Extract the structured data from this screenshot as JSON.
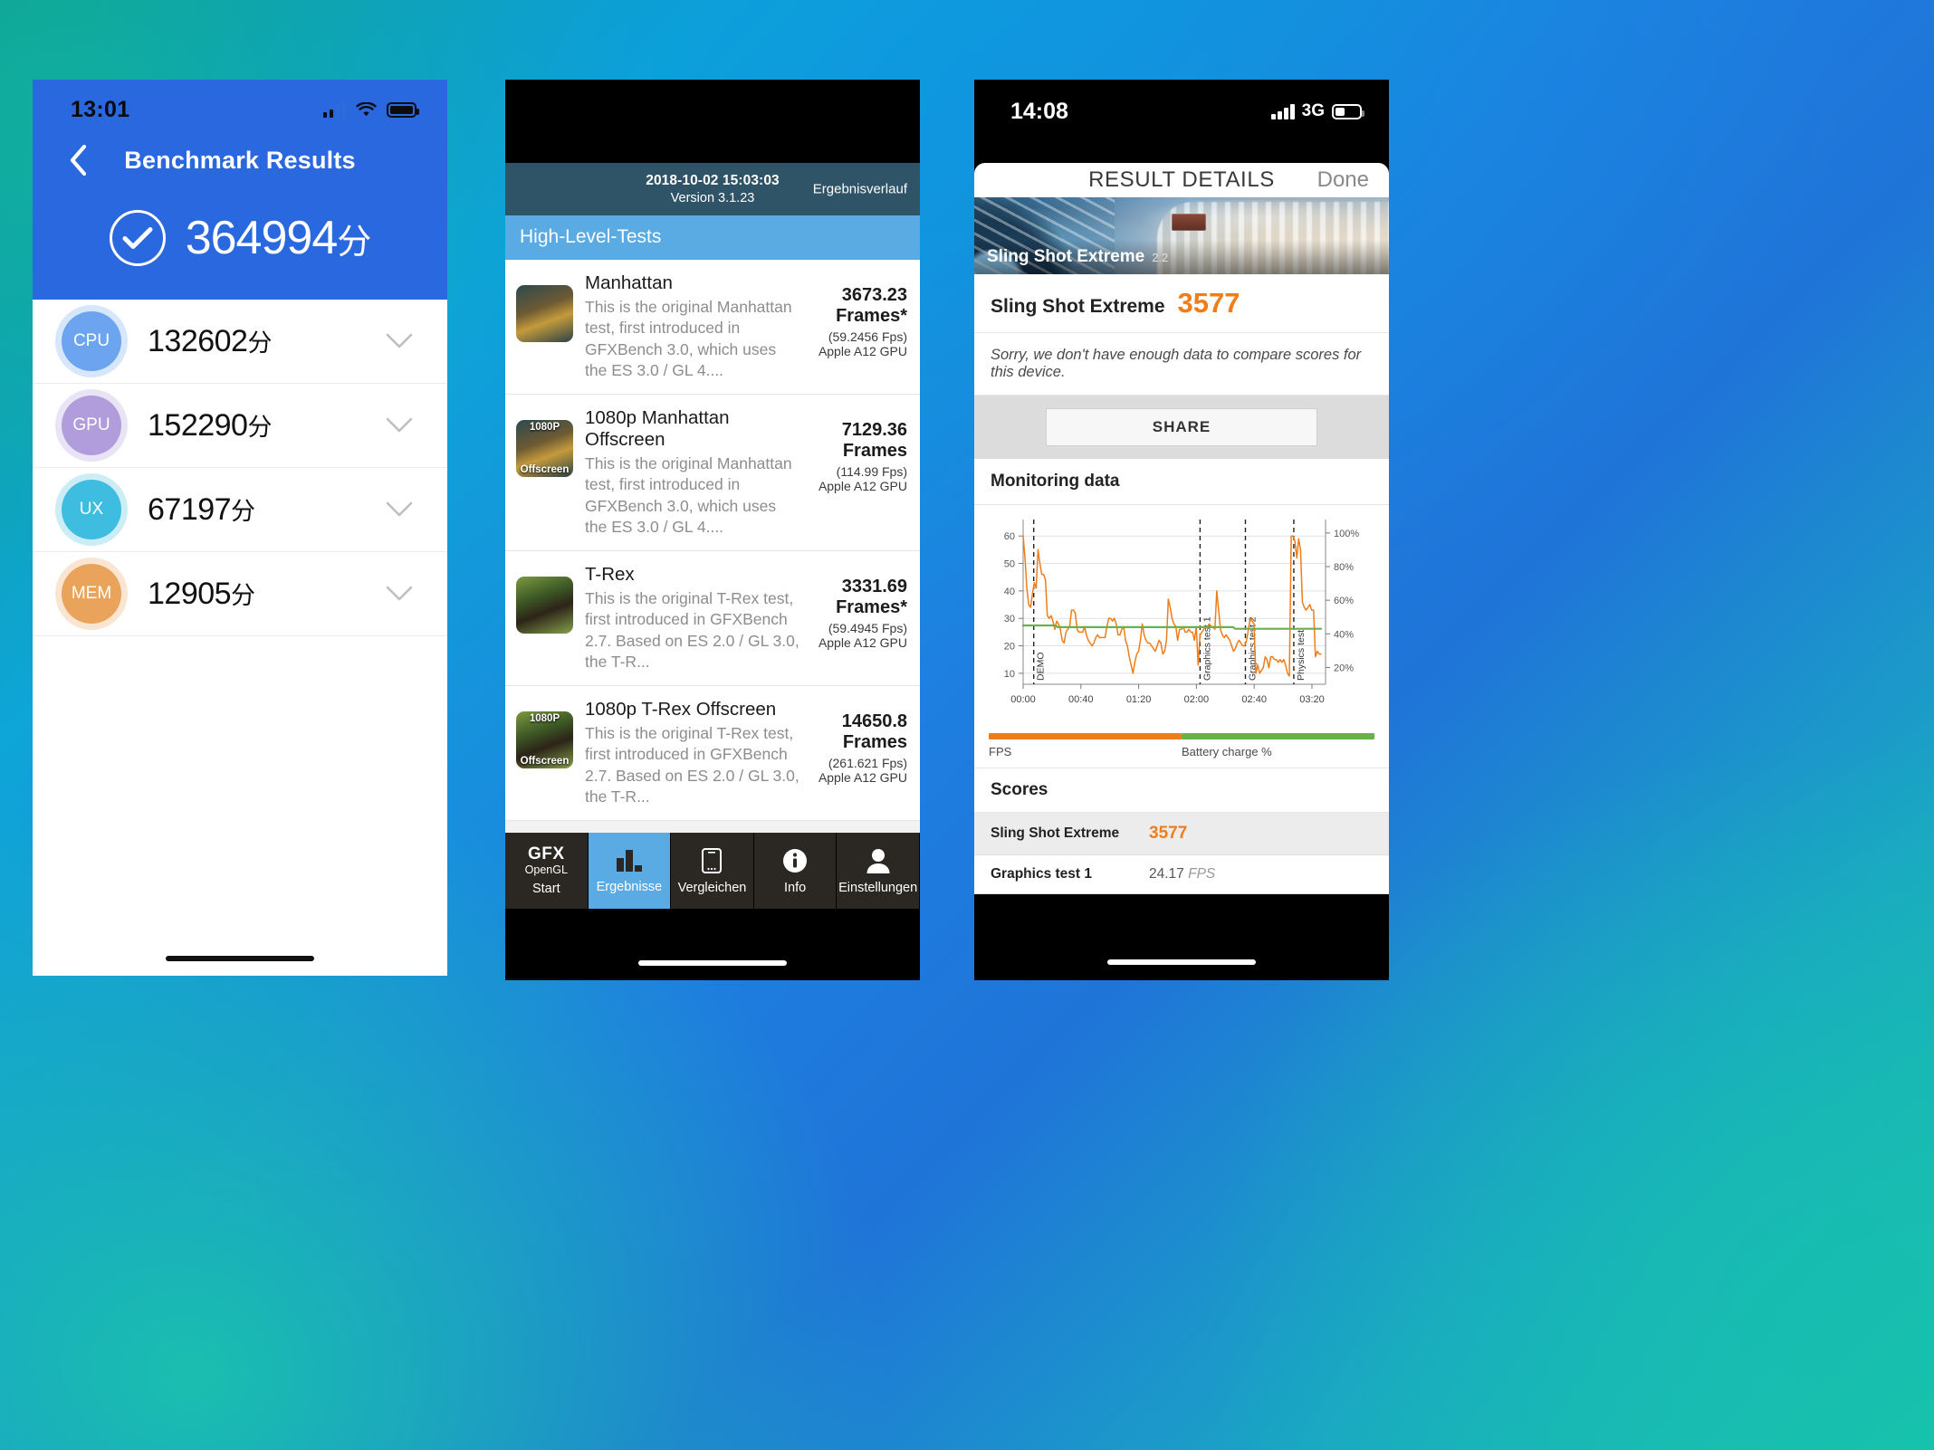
{
  "phone1": {
    "app": "AnTuTu Benchmark",
    "status": {
      "time": "13:01",
      "signal_icon": "signal-bars-icon",
      "wifi_icon": "wifi-icon",
      "battery_icon": "battery-full-icon"
    },
    "nav": {
      "back_icon": "chevron-left-icon",
      "title": "Benchmark Results"
    },
    "total": {
      "check_icon": "check-circle-icon",
      "score": "364994",
      "unit": "分"
    },
    "rows": [
      {
        "badge": "CPU",
        "score": "132602",
        "unit": "分",
        "color": "#6ca4ef",
        "chevron_icon": "chevron-down-icon"
      },
      {
        "badge": "GPU",
        "score": "152290",
        "unit": "分",
        "color": "#b19ddb",
        "chevron_icon": "chevron-down-icon"
      },
      {
        "badge": "UX",
        "score": "67197",
        "unit": "分",
        "color": "#3fbde0",
        "chevron_icon": "chevron-down-icon"
      },
      {
        "badge": "MEM",
        "score": "12905",
        "unit": "分",
        "color": "#e9a35a",
        "chevron_icon": "chevron-down-icon"
      }
    ]
  },
  "phone2": {
    "app": "GFXBench",
    "header": {
      "date": "2018-10-02 15:03:03",
      "version": "Version 3.1.23",
      "history": "Ergebnisverlauf"
    },
    "section_title": "High-Level-Tests",
    "tests": [
      {
        "name": "Manhattan",
        "desc": "This is the original Manhattan test, first introduced in GFXBench 3.0, which uses the ES 3.0 / GL 4....",
        "frames": "3673.23",
        "frames_unit": "Frames*",
        "fps": "(59.2456 Fps)",
        "gpu": "Apple A12 GPU",
        "thumb_top": "",
        "thumb_bottom": "",
        "thumb_kind": "manhattan"
      },
      {
        "name": "1080p Manhattan Offscreen",
        "desc": "This is the original Manhattan test, first introduced in GFXBench 3.0, which uses the ES 3.0 / GL 4....",
        "frames": "7129.36",
        "frames_unit": "Frames",
        "fps": "(114.99 Fps)",
        "gpu": "Apple A12 GPU",
        "thumb_top": "1080P",
        "thumb_bottom": "Offscreen",
        "thumb_kind": "manhattan"
      },
      {
        "name": "T-Rex",
        "desc": "This is the original T-Rex test, first introduced in GFXBench 2.7. Based on ES 2.0 / GL 3.0, the T-R...",
        "frames": "3331.69",
        "frames_unit": "Frames*",
        "fps": "(59.4945 Fps)",
        "gpu": "Apple A12 GPU",
        "thumb_top": "",
        "thumb_bottom": "",
        "thumb_kind": "trex"
      },
      {
        "name": "1080p T-Rex Offscreen",
        "desc": "This is the original T-Rex test, first introduced in GFXBench 2.7. Based on ES 2.0 / GL 3.0, the T-R...",
        "frames": "14650.8",
        "frames_unit": "Frames",
        "fps": "(261.621 Fps)",
        "gpu": "Apple A12 GPU",
        "thumb_top": "1080P",
        "thumb_bottom": "Offscreen",
        "thumb_kind": "trex"
      }
    ],
    "tabs": [
      {
        "label": "Start",
        "icon": "gfx-opengl-logo-icon",
        "brand": "GFX",
        "brand_sub": "OpenGL",
        "active": false
      },
      {
        "label": "Ergebnisse",
        "icon": "bar-chart-icon",
        "active": true
      },
      {
        "label": "Vergleichen",
        "icon": "phone-icon",
        "active": false
      },
      {
        "label": "Info",
        "icon": "info-circle-icon",
        "active": false
      },
      {
        "label": "Einstellungen",
        "icon": "person-icon",
        "active": false
      }
    ]
  },
  "phone3": {
    "app": "3DMark",
    "status": {
      "time": "14:08",
      "signal_icon": "signal-bars-icon",
      "network": "3G",
      "battery_icon": "battery-low-icon"
    },
    "nav": {
      "title": "RESULT DETAILS",
      "done": "Done"
    },
    "hero": {
      "title": "Sling Shot Extreme",
      "version": "2.2"
    },
    "score_line": {
      "label": "Sling Shot Extreme",
      "value": "3577",
      "accent": "#ef7d1a"
    },
    "note": "Sorry, we don't have enough data to compare scores for this device.",
    "share_label": "SHARE",
    "monitoring_title": "Monitoring data",
    "legend": [
      {
        "label": "FPS",
        "color": "#ef7d1a"
      },
      {
        "label": "Battery charge %",
        "color": "#6ab04c"
      }
    ],
    "scores_title": "Scores",
    "score_rows": [
      {
        "label": "Sling Shot Extreme",
        "value": "3577",
        "suffix": "",
        "accent": true
      },
      {
        "label": "Graphics test 1",
        "value": "24.17",
        "suffix": "FPS",
        "accent": false
      }
    ]
  },
  "chart_data": {
    "type": "line",
    "title": "Monitoring data",
    "xlabel": "",
    "ylabel": "FPS",
    "y2label": "Battery charge %",
    "xticks": [
      "00:00",
      "00:40",
      "01:20",
      "02:00",
      "02:40",
      "03:20"
    ],
    "yticks_left": [
      10,
      20,
      30,
      40,
      50,
      60
    ],
    "yticks_right": [
      "20%",
      "40%",
      "60%",
      "80%",
      "100%"
    ],
    "ylim": [
      6,
      66
    ],
    "y2lim": [
      10,
      108
    ],
    "grid": true,
    "legend_position": "bottom",
    "annotations": [
      {
        "label": "DEMO",
        "x": 0.035
      },
      {
        "label": "Graphics test 1",
        "x": 0.585
      },
      {
        "label": "Graphics test 2",
        "x": 0.735
      },
      {
        "label": "Physics test",
        "x": 0.895
      }
    ],
    "series": [
      {
        "name": "FPS",
        "color": "#ef7d1a",
        "axis": "left",
        "values": [
          60,
          52,
          41,
          35,
          34,
          39,
          43,
          41,
          55,
          50,
          46,
          46,
          44,
          31,
          30,
          31,
          29,
          26,
          29,
          28,
          26,
          22,
          21,
          25,
          26,
          27,
          33,
          33,
          32,
          26,
          25,
          25,
          25,
          27,
          24,
          22,
          21,
          20,
          21,
          23,
          24,
          23,
          23,
          23,
          23,
          27,
          30,
          30,
          29,
          30,
          28,
          24,
          24,
          26,
          27,
          22,
          20,
          16,
          13,
          10,
          14,
          17,
          18,
          22,
          28,
          24,
          22,
          21,
          21,
          20,
          19,
          18,
          20,
          22,
          21,
          17,
          18,
          22,
          37,
          34,
          30,
          28,
          27,
          22,
          26,
          26,
          27,
          25,
          25,
          26,
          25,
          25,
          22,
          27,
          13,
          24,
          25,
          26,
          27,
          27,
          28,
          27,
          27,
          26,
          40,
          33,
          26,
          24,
          23,
          24,
          23,
          22,
          20,
          18,
          19,
          21,
          22,
          21,
          20,
          20,
          22,
          26,
          30,
          29,
          28,
          10,
          13,
          10,
          11,
          12,
          16,
          15,
          12,
          16,
          16,
          15,
          15,
          14,
          15,
          14,
          15,
          13,
          10,
          9,
          60,
          60,
          58,
          52,
          59,
          55,
          36,
          34,
          33,
          34,
          35,
          33,
          33,
          16,
          18,
          17,
          17
        ]
      },
      {
        "name": "Battery charge %",
        "color": "#6ab04c",
        "axis": "right",
        "values": [
          45,
          45,
          45,
          45,
          45,
          45,
          45,
          45,
          45,
          45,
          45,
          45,
          45,
          45,
          45,
          45,
          45,
          45,
          44,
          44,
          44,
          44,
          44,
          44,
          44,
          44,
          44,
          44,
          44,
          44,
          44,
          44,
          44,
          44,
          44,
          44,
          44,
          44,
          44,
          44,
          44,
          44,
          44,
          44,
          44,
          44,
          44,
          44,
          44,
          44,
          44,
          44,
          44,
          44,
          44,
          44,
          44,
          44,
          44,
          44,
          44,
          44,
          44,
          44,
          44,
          44,
          44,
          44,
          44,
          44,
          44,
          44,
          44,
          44,
          44,
          44,
          44,
          44,
          44,
          44,
          44,
          44,
          44,
          44,
          44,
          44,
          44,
          44,
          44,
          44,
          44,
          44,
          44,
          44,
          44,
          44,
          44,
          44,
          44,
          44,
          44,
          44,
          44,
          44,
          44,
          44,
          44,
          44,
          44,
          44,
          44,
          43,
          43,
          43,
          43,
          43,
          43,
          43,
          43,
          43,
          43,
          43,
          43,
          43,
          43,
          43,
          43,
          43,
          43,
          43,
          43,
          43,
          43,
          43,
          43,
          43,
          43,
          43,
          43,
          43,
          43,
          43,
          43,
          43,
          43,
          43,
          43,
          43,
          43,
          43,
          43,
          43,
          43,
          43,
          43,
          43,
          43
        ]
      }
    ]
  }
}
